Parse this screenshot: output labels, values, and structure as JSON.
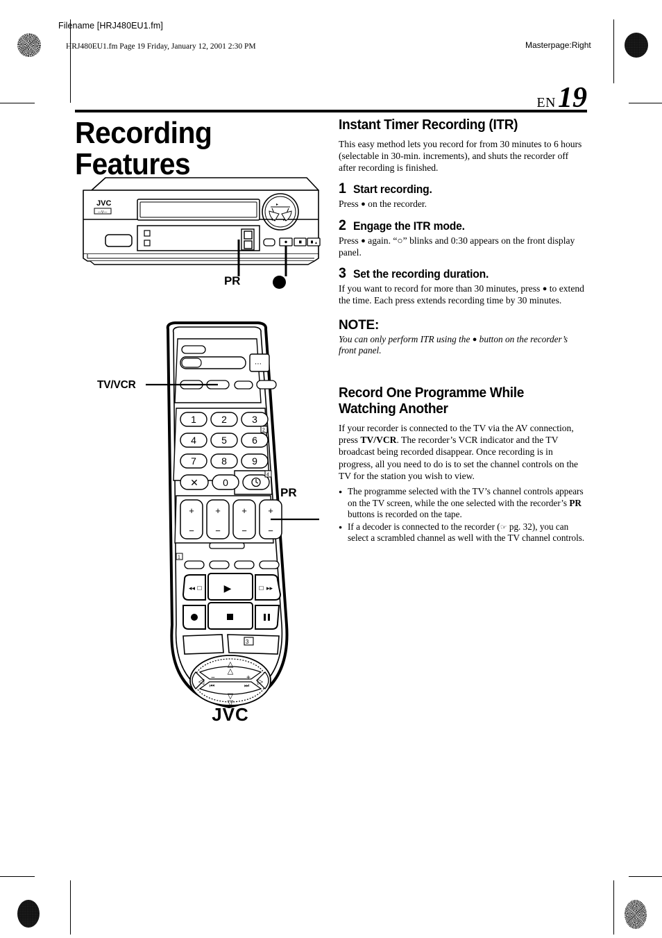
{
  "header": {
    "filename_slug": "Filename [HRJ480EU1.fm]",
    "fileinfo_slug": "HRJ480EU1.fm  Page 19  Friday, January 12, 2001  2:30 PM",
    "masterpage": "Masterpage:Right",
    "lang_code": "EN",
    "page_number": "19"
  },
  "left_column": {
    "title": "Recording Features",
    "vcr_figure": {
      "brand": "JVC",
      "callout_pr": "PR",
      "callout_record": "●"
    },
    "remote_figure": {
      "brand": "JVC",
      "callout_tvvcr": "TV/VCR",
      "callout_pr": "PR",
      "keypad": [
        "1",
        "2",
        "3",
        "4",
        "5",
        "6",
        "7",
        "8",
        "9"
      ],
      "keypad_extra": [
        "✕",
        "0",
        "◴"
      ],
      "plus_minus": [
        "+",
        "−"
      ],
      "marker_2": "2",
      "marker_4": "4",
      "marker_1": "1",
      "marker_3": "3"
    }
  },
  "right_column": {
    "section1": {
      "heading": "Instant Timer Recording (ITR)",
      "intro": "This easy method lets you record for from 30 minutes to 6 hours (selectable in 30-min. increments), and shuts the recorder off after recording is finished.",
      "steps": [
        {
          "number": "1",
          "title": "Start recording.",
          "body_pre": "Press ",
          "body_post": " on the recorder."
        },
        {
          "number": "2",
          "title": "Engage the ITR mode.",
          "body_pre": "Press ",
          "body_post": " again. “○” blinks and 0:30 appears on the front display panel."
        },
        {
          "number": "3",
          "title": "Set the recording duration.",
          "body_pre": "If you want to record for more than 30 minutes, press ",
          "body_post": " to extend the time. Each press extends recording time by 30 minutes."
        }
      ],
      "note_heading": "NOTE:",
      "note_pre": "You can only perform ITR using the ",
      "note_post": " button on the recorder’s front panel."
    },
    "section2": {
      "heading": "Record One Programme While Watching Another",
      "para_1": "If your recorder is connected to the TV via the AV connection, press ",
      "para_1_bold": "TV/VCR",
      "para_1_cont": ". The recorder’s VCR indicator and the TV broadcast being recorded disappear. Once recording is in progress, all you need to do is to set the channel controls on the TV for the station you wish to view.",
      "bullets": [
        {
          "text_a": "The programme selected with the TV’s channel controls appears on the TV screen, while the one selected with the recorder’s ",
          "bold": "PR",
          "text_b": " buttons is recorded on the tape."
        },
        {
          "text_a": "If a decoder is connected to the recorder (",
          "ref_symbol": "☞",
          "text_b": " pg. 32), you can select a scrambled channel as well with the TV channel controls."
        }
      ]
    }
  }
}
